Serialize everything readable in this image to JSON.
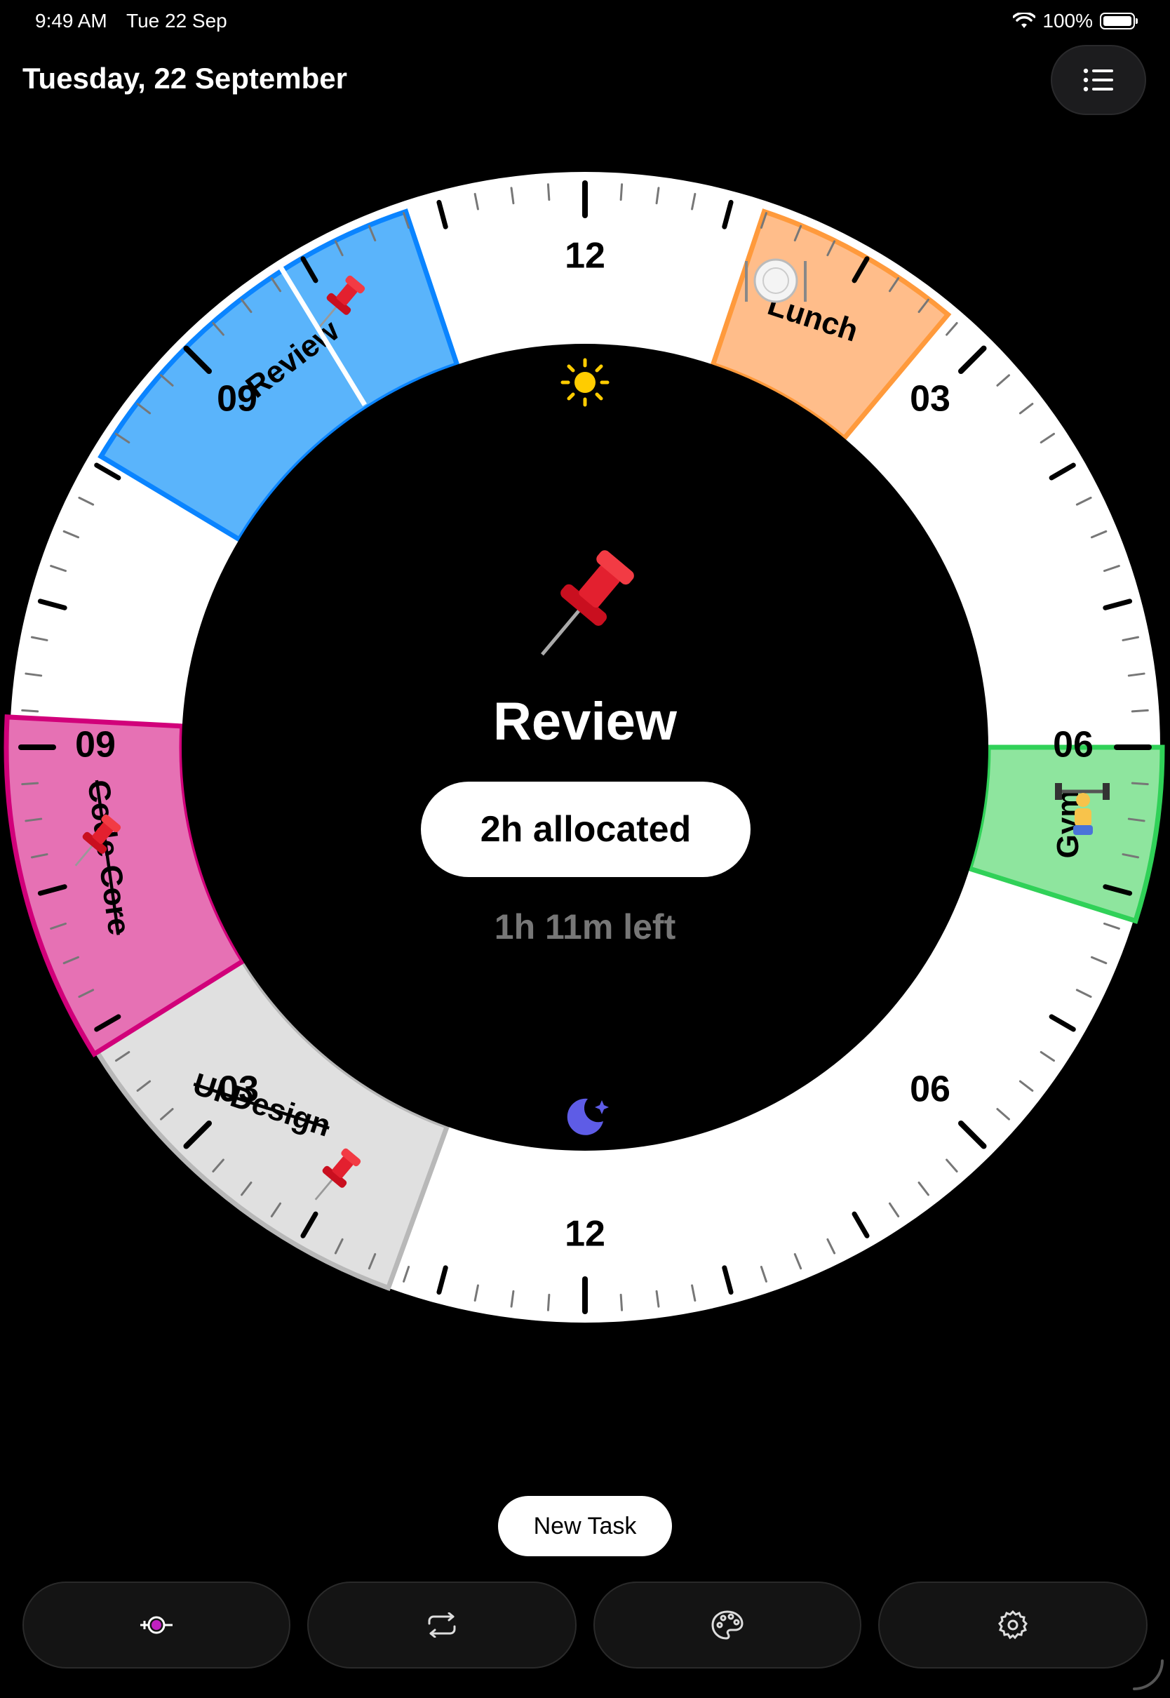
{
  "status_bar": {
    "time": "9:49 AM",
    "date": "Tue 22 Sep",
    "battery": "100%"
  },
  "header": {
    "title": "Tuesday, 22 September"
  },
  "dial": {
    "hour_labels": [
      "12",
      "03",
      "06",
      "09",
      "12",
      "03",
      "06",
      "09"
    ],
    "tasks": [
      {
        "name": "Review",
        "color": "#5ab4fb",
        "border": "#0a84ff",
        "done": false,
        "current": true
      },
      {
        "name": "Lunch",
        "color": "#ffbd8a",
        "border": "#ff9a3c",
        "done": false
      },
      {
        "name": "Gym",
        "color": "#8ee59e",
        "border": "#30d158",
        "done": false
      },
      {
        "name": "UI Design",
        "color": "#e0e0e0",
        "border": "#b8b8b8",
        "done": true
      },
      {
        "name": "Code Core",
        "color": "#e671b4",
        "border": "#d1007a",
        "done": true
      }
    ]
  },
  "current_task": {
    "name": "Review",
    "allocated": "2h allocated",
    "remaining": "1h 11m left"
  },
  "new_task_label": "New Task",
  "tabs": [
    "timer-icon",
    "repeat-icon",
    "palette-icon",
    "gear-icon"
  ]
}
